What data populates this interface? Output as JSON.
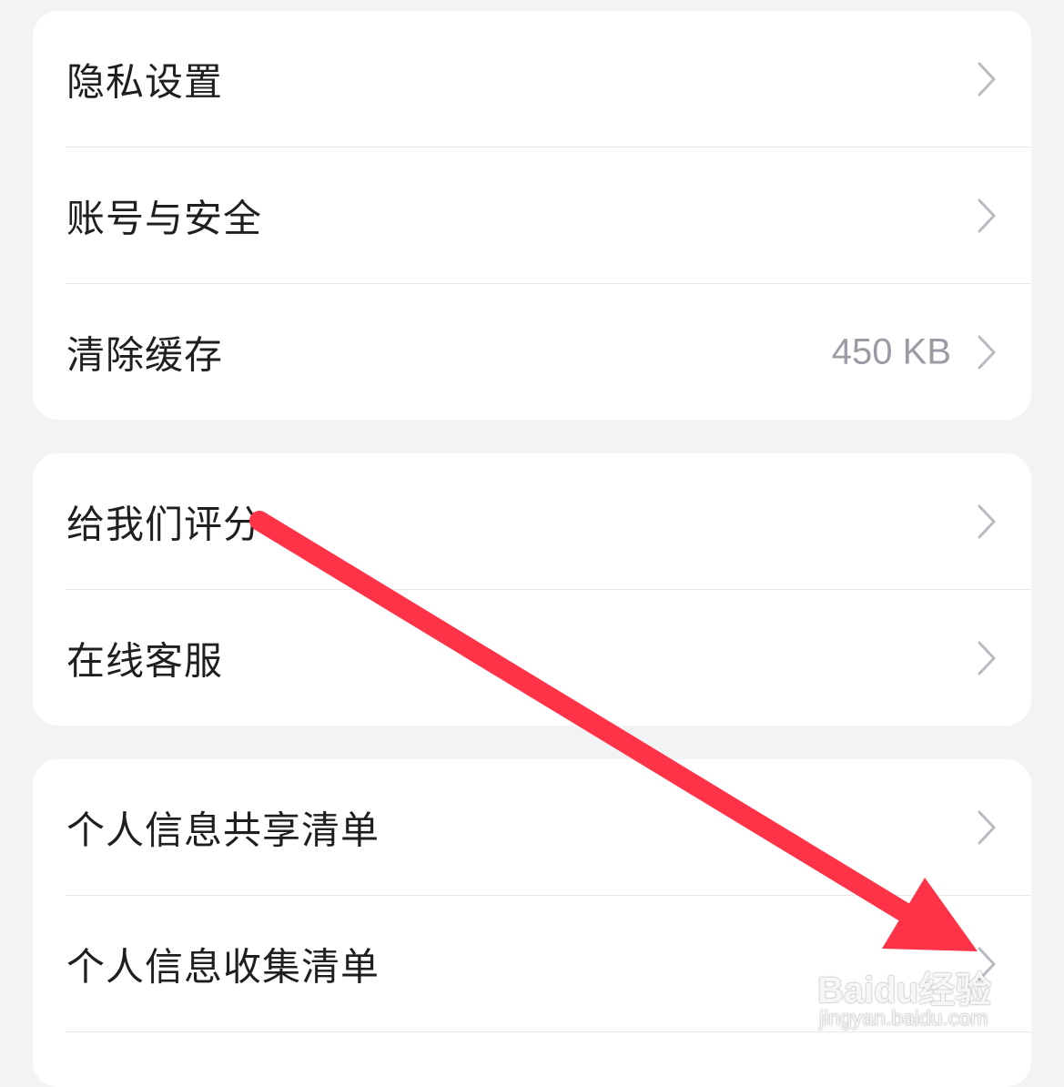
{
  "groups": [
    {
      "items": [
        {
          "label": "隐私设置",
          "value": ""
        },
        {
          "label": "账号与安全",
          "value": ""
        },
        {
          "label": "清除缓存",
          "value": "450 KB"
        }
      ]
    },
    {
      "items": [
        {
          "label": "给我们评分",
          "value": ""
        },
        {
          "label": "在线客服",
          "value": ""
        }
      ]
    },
    {
      "items": [
        {
          "label": "个人信息共享清单",
          "value": ""
        },
        {
          "label": "个人信息收集清单",
          "value": ""
        }
      ]
    }
  ],
  "icons": {
    "row_chevron": "chevron-right-icon",
    "annotation": "red-arrow-annotation"
  },
  "colors": {
    "page_background": "#f2f3f5",
    "card_background": "#ffffff",
    "label_text": "#1f1f1f",
    "value_text": "#9a9ca3",
    "chevron": "#b9bbc1",
    "annotation_arrow": "#ff3347"
  },
  "watermark": {
    "brand": "Baidu经验",
    "url": "jingyan.baidu.com"
  }
}
